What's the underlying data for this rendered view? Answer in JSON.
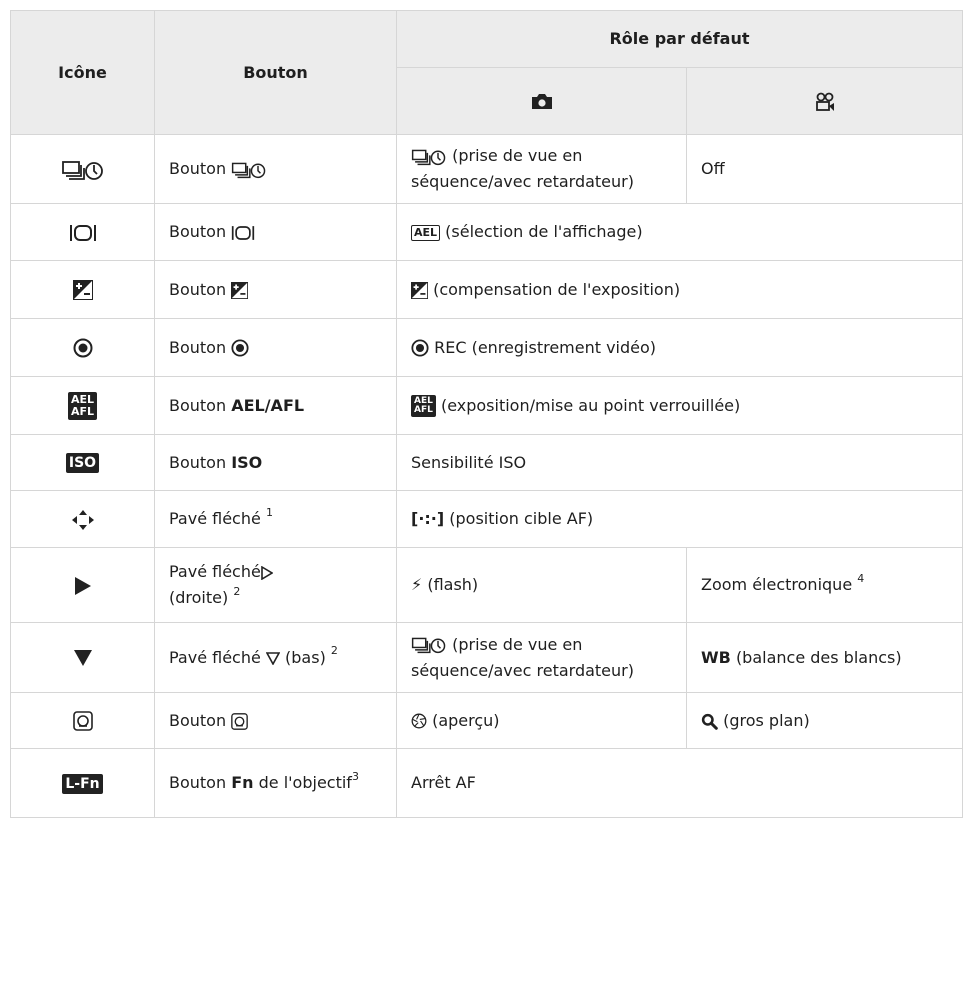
{
  "header": {
    "col_icon": "Icône",
    "col_button": "Bouton",
    "col_role": "Rôle par défaut",
    "photo_icon": "camera-icon",
    "movie_icon": "movie-camera-icon"
  },
  "rows": [
    {
      "icon": "sequential-selftimer-icon",
      "button_prefix": "Bouton",
      "button_bold": "",
      "photo": "(prise de vue en séquence/avec retardateur)",
      "movie": "Off"
    },
    {
      "icon": "display-select-icon",
      "button_prefix": "Bouton",
      "button_bold": "",
      "photo_badge": "AEL",
      "photo": "(sélection de l'affichage)",
      "movie": ""
    },
    {
      "icon": "exposure-compensation-icon",
      "button_prefix": "Bouton",
      "button_bold": "",
      "photo": "(compensation de l'exposition)",
      "movie": ""
    },
    {
      "icon": "record-icon",
      "button_prefix": "Bouton",
      "button_bold": "",
      "photo": "REC (enregistrement vidéo)",
      "movie": ""
    },
    {
      "icon": "ael-afl-icon",
      "icon_text_top": "AEL",
      "icon_text_bottom": "AFL",
      "button_prefix": "Bouton",
      "button_bold": "AEL/AFL",
      "photo": "(exposition/mise au point verrouillée)",
      "movie": ""
    },
    {
      "icon": "iso-icon",
      "icon_text": "ISO",
      "button_prefix": "Bouton",
      "button_bold": "ISO",
      "photo": "Sensibilité ISO",
      "movie": ""
    },
    {
      "icon": "arrow-pad-icon",
      "button_prefix": "Pavé fléché",
      "button_sup": "1",
      "photo_glyph": "[·:·]",
      "photo": "(position cible AF)",
      "movie": ""
    },
    {
      "icon": "play-right-icon",
      "button_prefix": "Pavé fléché",
      "button_suffix": "(droite)",
      "button_sup": "2",
      "photo": "(flash)",
      "movie": "Zoom électronique",
      "movie_sup": "4"
    },
    {
      "icon": "down-triangle-icon",
      "button_prefix": "Pavé fléché",
      "button_suffix": "(bas)",
      "button_sup": "2",
      "photo": "(prise de vue en séquence/avec retardateur)",
      "movie_bold": "WB",
      "movie": "(balance des blancs)"
    },
    {
      "icon": "preview-button-icon",
      "button_prefix": "Bouton",
      "button_bold": "",
      "photo": "(aperçu)",
      "movie": "(gros plan)"
    },
    {
      "icon": "lens-fn-icon",
      "icon_text": "L-Fn",
      "button_prefix": "Bouton",
      "button_bold": "Fn",
      "button_suffix": "de l'objectif",
      "button_sup": "3",
      "photo": "Arrêt AF",
      "movie": ""
    }
  ]
}
